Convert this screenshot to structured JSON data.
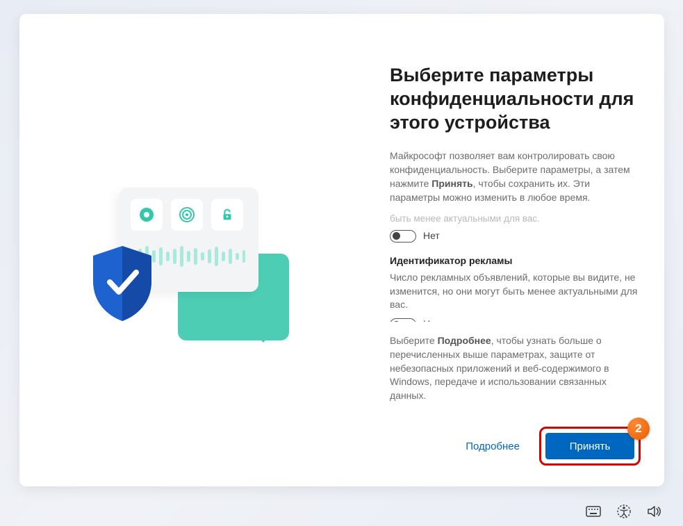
{
  "title": "Выберите параметры конфиденциальности для этого устройства",
  "intro_pre": "Майкрософт позволяет вам контролировать свою конфиденциальность. Выберите параметры, а затем нажмите ",
  "intro_bold": "Принять",
  "intro_post": ", чтобы сохранить их. Эти параметры можно изменить в любое время.",
  "faded_prev": "быть менее актуальными для вас.",
  "toggle_off_label": "Нет",
  "section2_title": "Идентификатор рекламы",
  "section2_desc": "Число рекламных объявлений, которые вы видите, не изменится, но они могут быть менее актуальными для вас.",
  "footer_pre": "Выберите ",
  "footer_bold": "Подробнее",
  "footer_post": ", чтобы узнать больше о перечисленных выше параметрах, защите от небезопасных приложений и веб-содержимого в Windows, передаче и использовании связанных данных.",
  "more_button": "Подробнее",
  "accept_button": "Принять",
  "step_number": "2"
}
